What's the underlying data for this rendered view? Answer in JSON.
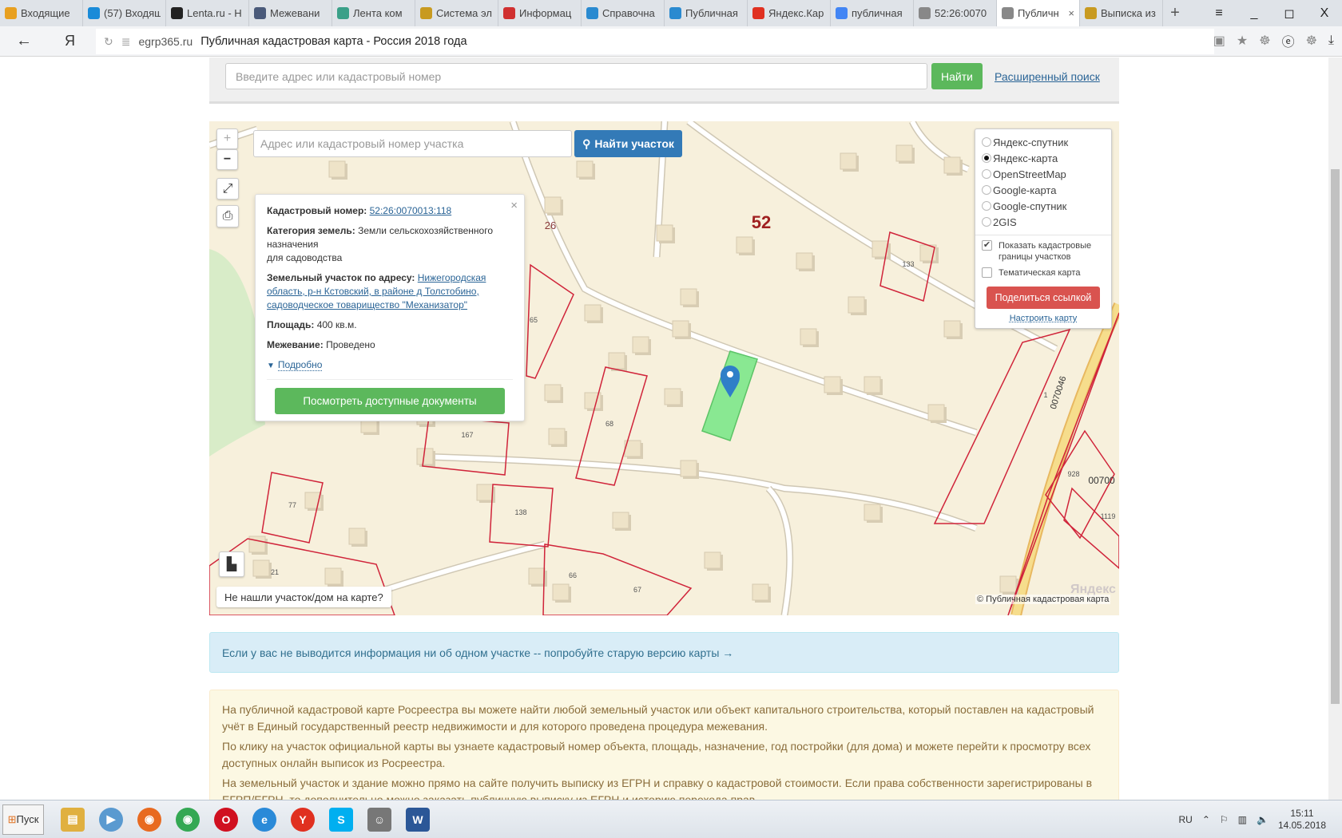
{
  "browser": {
    "tabs": [
      {
        "label": "Входящие",
        "icon": "mail-icon",
        "color": "#e8a020"
      },
      {
        "label": "(57) Входящ",
        "icon": "mail-ru-icon",
        "color": "#1a8bd8"
      },
      {
        "label": "Lenta.ru - Н",
        "icon": "lenta-icon",
        "color": "#222222"
      },
      {
        "label": "Межевани",
        "icon": "nn-icon",
        "color": "#4a5a7a"
      },
      {
        "label": "Лента ком",
        "icon": "feed-icon",
        "color": "#3aa088"
      },
      {
        "label": "Система эл",
        "icon": "emblem-icon",
        "color": "#c89a20"
      },
      {
        "label": "Информац",
        "icon": "hammer-icon",
        "color": "#d03030"
      },
      {
        "label": "Справочна",
        "icon": "pin-blue-icon",
        "color": "#2a8ad0"
      },
      {
        "label": "Публичная",
        "icon": "pin-blue-icon",
        "color": "#2a8ad0"
      },
      {
        "label": "Яндекс.Кар",
        "icon": "map-pin-icon",
        "color": "#e03020"
      },
      {
        "label": "публичная",
        "icon": "google-icon",
        "color": "#4285f4"
      },
      {
        "label": "52:26:0070",
        "icon": "document-icon",
        "color": "#888888"
      },
      {
        "label": "Публичн",
        "icon": "document-icon",
        "color": "#888888",
        "active": true
      },
      {
        "label": "Выписка из",
        "icon": "emblem-icon",
        "color": "#c89a20"
      }
    ],
    "window_controls": [
      "≡",
      "_",
      "◻",
      "X"
    ],
    "url_domain": "egrp365.ru",
    "page_title": "Публичная кадастровая карта - Россия 2018 года"
  },
  "search": {
    "placeholder": "Введите адрес или кадастровый номер",
    "button": "Найти",
    "advanced_link": "Расширенный поиск"
  },
  "map": {
    "search_placeholder": "Адрес или кадастровый номер участка",
    "find_button": "Найти участок",
    "zoom_in": "+",
    "zoom_out": "−",
    "popup": {
      "cadastral_label": "Кадастровый номер:",
      "cadastral_value": "52:26:0070013:118",
      "category_label": "Категория земель:",
      "category_value": "Земли сельскохозяйственного назначения",
      "category_use": "для садоводства",
      "address_label": "Земельный участок по адресу:",
      "address_value": "Нижегородская область, р-н Кстовский, в районе д Толстобино, садоводческое товарищество \"Механизатор\"",
      "area_label": "Площадь:",
      "area_value": "400 кв.м.",
      "survey_label": "Межевание:",
      "survey_value": "Проведено",
      "more_link": "Подробно",
      "docs_button": "Посмотреть доступные документы"
    },
    "layers": {
      "options": [
        {
          "label": "Яндекс-спутник",
          "selected": false
        },
        {
          "label": "Яндекс-карта",
          "selected": true
        },
        {
          "label": "OpenStreetMap",
          "selected": false
        },
        {
          "label": "Google-карта",
          "selected": false
        },
        {
          "label": "Google-спутник",
          "selected": false
        },
        {
          "label": "2GIS",
          "selected": false
        }
      ],
      "show_borders": {
        "label": "Показать кадастровые границы участков",
        "checked": true
      },
      "thematic": {
        "label": "Тематическая карта",
        "checked": false
      },
      "share_button": "Поделиться ссылкой",
      "config_link": "Настроить карту"
    },
    "not_found": "Не нашли участок/дом на карте?",
    "attribution": "© Публичная кадастровая карта",
    "provider_logo": "Яндекс",
    "labels": [
      "26",
      "52",
      "133",
      "65",
      "68",
      "167",
      "77",
      "138",
      "21",
      "66",
      "67",
      "928",
      "00700",
      "1119",
      "0070046",
      "1"
    ],
    "colors": {
      "parcel_border": "#d0243a",
      "selected_parcel": "#7ee88a",
      "marker": "#2f7fc8"
    }
  },
  "info_notice": "Если у вас не выводится информация ни об одном участке -- попробуйте старую версию карты →",
  "description": [
    "На публичной кадастровой карте Росреестра вы можете найти любой земельный участок или объект капитального строительства, который поставлен на кадастровый учёт в Единый государственный реестр недвижимости и для которого проведена процедура межевания.",
    "По клику на участок официальной карты вы узнаете кадастровый номер объекта, площадь, назначение, год постройки (для дома) и можете перейти к просмотру всех доступных онлайн выписок из Росреестра.",
    "На земельный участок и здание можно прямо на сайте получить выписку из ЕГРН и справку о кадастровой стоимости. Если права собственности зарегистрированы в ЕГРП/ЕГРН, то дополнительно можно заказать публичную выписку из ЕГРН и историю перехода прав."
  ],
  "taskbar": {
    "start": "Пуск",
    "apps": [
      {
        "icon": "explorer-icon",
        "color": "#e0b040",
        "glyph": "▤"
      },
      {
        "icon": "media-player-icon",
        "color": "#5a9ad0",
        "glyph": "▶"
      },
      {
        "icon": "firefox-icon",
        "color": "#e86a20",
        "glyph": "◉"
      },
      {
        "icon": "chrome-icon",
        "color": "#34a853",
        "glyph": "◉"
      },
      {
        "icon": "opera-icon",
        "color": "#d01020",
        "glyph": "O"
      },
      {
        "icon": "ie-icon",
        "color": "#2a8ad8",
        "glyph": "e"
      },
      {
        "icon": "yandex-browser-icon",
        "color": "#e03020",
        "glyph": "Y"
      },
      {
        "icon": "skype-icon",
        "color": "#00aff0",
        "glyph": "S"
      },
      {
        "icon": "scholar-icon",
        "color": "#777777",
        "glyph": "☺"
      },
      {
        "icon": "word-icon",
        "color": "#2b5797",
        "glyph": "W"
      }
    ],
    "lang": "RU",
    "time": "15:11",
    "date": "14.05.2018"
  }
}
